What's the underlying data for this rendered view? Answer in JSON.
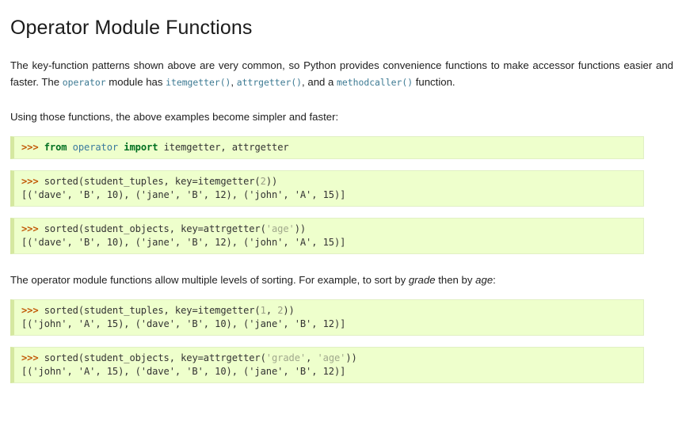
{
  "page": {
    "title": "Operator Module Functions",
    "background_color": "#ffffff",
    "text_color": "#202020"
  },
  "paragraphs": {
    "intro": {
      "part1": "The key-function patterns shown above are very common, so Python provides convenience functions to make accessor functions easier and faster. The ",
      "code1": "operator",
      "part2": " module has ",
      "code2": "itemgetter()",
      "part3": ", ",
      "code3": "attrgetter()",
      "part4": ", and a ",
      "code4": "methodcaller()",
      "part5": " function."
    },
    "lead_in": "Using those functions, the above examples become simpler and faster:",
    "multi_level": {
      "part1": "The operator module functions allow multiple levels of sorting. For example, to sort by ",
      "em1": "grade",
      "part2": " then by ",
      "em2": "age",
      "part3": ":"
    }
  },
  "code_blocks": [
    {
      "name": "import-statement",
      "lines": [
        {
          "tokens": [
            {
              "t": ">>> ",
              "c": "tok-prompt"
            },
            {
              "t": "from",
              "c": "tok-keyword"
            },
            {
              "t": " ",
              "c": "tok-name"
            },
            {
              "t": "operator",
              "c": "tok-module"
            },
            {
              "t": " ",
              "c": "tok-name"
            },
            {
              "t": "import",
              "c": "tok-keyword"
            },
            {
              "t": " itemgetter, attrgetter",
              "c": "tok-name"
            }
          ]
        }
      ]
    },
    {
      "name": "sorted-itemgetter-age",
      "lines": [
        {
          "tokens": [
            {
              "t": ">>> ",
              "c": "tok-prompt"
            },
            {
              "t": "sorted(student_tuples, key=itemgetter(",
              "c": "tok-name"
            },
            {
              "t": "2",
              "c": "tok-number"
            },
            {
              "t": "))",
              "c": "tok-name"
            }
          ]
        },
        {
          "tokens": [
            {
              "t": "[('dave', 'B', 10), ('jane', 'B', 12), ('john', 'A', 15)]",
              "c": "tok-output"
            }
          ]
        }
      ]
    },
    {
      "name": "sorted-attrgetter-age",
      "lines": [
        {
          "tokens": [
            {
              "t": ">>> ",
              "c": "tok-prompt"
            },
            {
              "t": "sorted(student_objects, key=attrgetter(",
              "c": "tok-name"
            },
            {
              "t": "'age'",
              "c": "tok-string"
            },
            {
              "t": "))",
              "c": "tok-name"
            }
          ]
        },
        {
          "tokens": [
            {
              "t": "[('dave', 'B', 10), ('jane', 'B', 12), ('john', 'A', 15)]",
              "c": "tok-output"
            }
          ]
        }
      ]
    },
    {
      "name": "sorted-itemgetter-grade-age",
      "lines": [
        {
          "tokens": [
            {
              "t": ">>> ",
              "c": "tok-prompt"
            },
            {
              "t": "sorted(student_tuples, key=itemgetter(",
              "c": "tok-name"
            },
            {
              "t": "1",
              "c": "tok-number"
            },
            {
              "t": ", ",
              "c": "tok-name"
            },
            {
              "t": "2",
              "c": "tok-number"
            },
            {
              "t": "))",
              "c": "tok-name"
            }
          ]
        },
        {
          "tokens": [
            {
              "t": "[('john', 'A', 15), ('dave', 'B', 10), ('jane', 'B', 12)]",
              "c": "tok-output"
            }
          ]
        }
      ]
    },
    {
      "name": "sorted-attrgetter-grade-age",
      "lines": [
        {
          "tokens": [
            {
              "t": ">>> ",
              "c": "tok-prompt"
            },
            {
              "t": "sorted(student_objects, key=attrgetter(",
              "c": "tok-name"
            },
            {
              "t": "'grade'",
              "c": "tok-string"
            },
            {
              "t": ", ",
              "c": "tok-name"
            },
            {
              "t": "'age'",
              "c": "tok-string"
            },
            {
              "t": "))",
              "c": "tok-name"
            }
          ]
        },
        {
          "tokens": [
            {
              "t": "[('john', 'A', 15), ('dave', 'B', 10), ('jane', 'B', 12)]",
              "c": "tok-output"
            }
          ]
        }
      ]
    }
  ],
  "colors": {
    "code_background": "#eeffcc",
    "code_left_border": "#d5e8a0",
    "prompt": "#c15806",
    "keyword": "#007020",
    "module": "#3a7a9e",
    "inline_code": "#3d7a93",
    "string": "#a0a88c",
    "number": "#9a9f85"
  }
}
